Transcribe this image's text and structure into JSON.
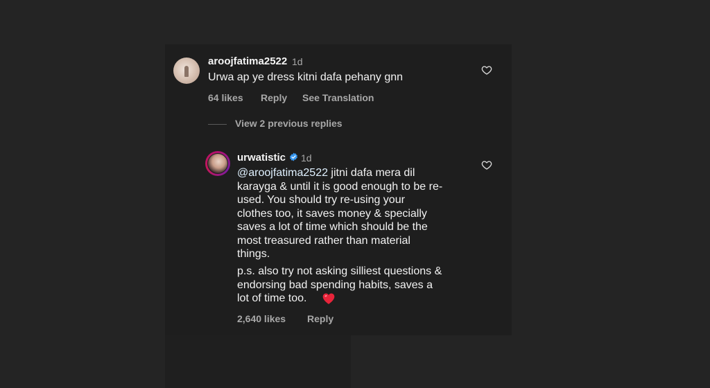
{
  "comment": {
    "username": "aroojfatima2522",
    "time": "1d",
    "text": "Urwa ap ye dress kitni dafa pehany gnn",
    "likes": "64 likes",
    "reply_label": "Reply",
    "translation_label": "See Translation"
  },
  "view_replies_label": "View 2 previous replies",
  "reply": {
    "username": "urwatistic",
    "verified": true,
    "time": "1d",
    "mention": "@aroojfatima2522",
    "lines": [
      " jitni dafa mera dil",
      "karayga & until it is good enough to be re-",
      "used. You should try re-using your",
      "clothes too, it saves money & specially",
      "saves a lot of time which should be the",
      "most treasured rather than material",
      "things."
    ],
    "ps_lines": [
      "p.s. also try not asking silliest questions &",
      "endorsing bad spending habits, saves a",
      "lot of time too. "
    ],
    "likes": "2,640 likes",
    "reply_label": "Reply"
  },
  "colors": {
    "background": "#242424",
    "panel": "#1e1e1e",
    "text": "#f5f5f5",
    "muted": "#a8a8a8",
    "verified": "#3797f0",
    "heart_emoji": "#e8243a"
  },
  "icons": [
    "avatar",
    "heart-icon",
    "verified-badge-icon",
    "red-heart-emoji"
  ]
}
